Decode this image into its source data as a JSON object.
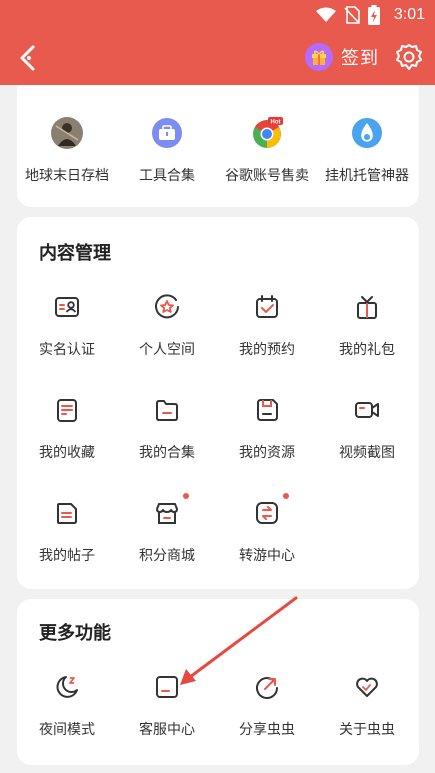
{
  "status_bar": {
    "time": "3:01"
  },
  "header": {
    "checkin_label": "签到"
  },
  "top_apps": [
    {
      "label": "地球末日存档",
      "icon": "game-avatar-icon"
    },
    {
      "label": "工具合集",
      "icon": "toolbox-icon"
    },
    {
      "label": "谷歌账号售卖",
      "icon": "chrome-hot-icon"
    },
    {
      "label": "挂机托管神器",
      "icon": "water-drop-icon"
    }
  ],
  "content_section": {
    "title": "内容管理",
    "items": [
      {
        "label": "实名认证",
        "icon": "id-card-icon"
      },
      {
        "label": "个人空间",
        "icon": "star-circle-icon"
      },
      {
        "label": "我的预约",
        "icon": "calendar-check-icon"
      },
      {
        "label": "我的礼包",
        "icon": "gift-box-icon"
      },
      {
        "label": "我的收藏",
        "icon": "collection-icon"
      },
      {
        "label": "我的合集",
        "icon": "folder-icon"
      },
      {
        "label": "我的资源",
        "icon": "floppy-icon"
      },
      {
        "label": "视频截图",
        "icon": "video-icon"
      },
      {
        "label": "我的帖子",
        "icon": "post-icon"
      },
      {
        "label": "积分商城",
        "icon": "store-icon",
        "badge": true
      },
      {
        "label": "转游中心",
        "icon": "transfer-icon",
        "badge": true
      }
    ]
  },
  "more_section": {
    "title": "更多功能",
    "items": [
      {
        "label": "夜间模式",
        "icon": "moon-icon"
      },
      {
        "label": "客服中心",
        "icon": "feedback-icon"
      },
      {
        "label": "分享虫虫",
        "icon": "share-icon"
      },
      {
        "label": "关于虫虫",
        "icon": "heart-icon"
      }
    ]
  },
  "colors": {
    "brand": "#e85a4d",
    "icon_dark": "#333333",
    "accent": "#e85a4d"
  }
}
